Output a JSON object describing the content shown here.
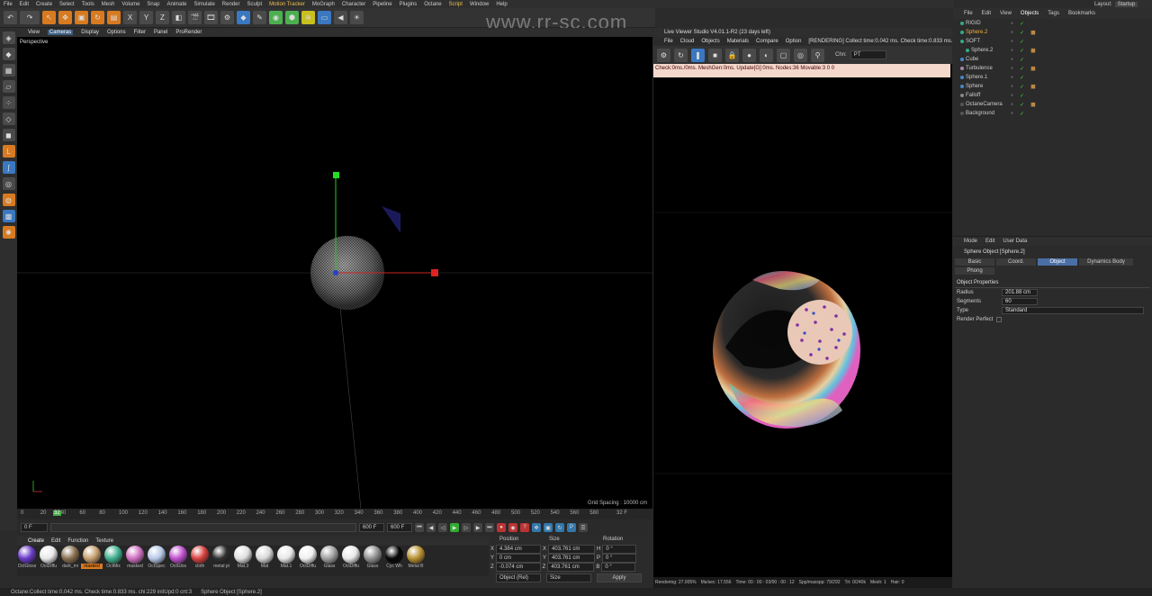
{
  "menu": [
    "File",
    "Edit",
    "Create",
    "Select",
    "Tools",
    "Mesh",
    "Volume",
    "Snap",
    "Animate",
    "Simulate",
    "Render",
    "Sculpt",
    "Motion Tracker",
    "MoGraph",
    "Character",
    "Pipeline",
    "Plugins",
    "Octane",
    "Script",
    "Window",
    "Help"
  ],
  "watermark": "www.rr-sc.com",
  "viewport": {
    "menu": [
      "View",
      "Cameras",
      "Display",
      "Options",
      "Filter",
      "Panel",
      "ProRender"
    ],
    "label": "Perspective",
    "grid_info": "Grid Spacing : 10000 cm"
  },
  "timeline": {
    "ticks": [
      "0",
      "20",
      "40",
      "60",
      "80",
      "100",
      "120",
      "140",
      "160",
      "180",
      "200",
      "220",
      "240",
      "260",
      "280",
      "300",
      "320",
      "340",
      "360",
      "380",
      "400",
      "420",
      "440",
      "460",
      "480",
      "500",
      "520",
      "540",
      "560",
      "580"
    ],
    "current": "32",
    "current_field": "32 F",
    "start_field": "0 F",
    "end_field": "600 F",
    "end_field2": "600 F"
  },
  "materials": {
    "tabs": [
      "Create",
      "Edit",
      "Function",
      "Texture"
    ],
    "items": [
      {
        "name": "OctGloss",
        "color": "#6a3cc8"
      },
      {
        "name": "OctDiffu",
        "color": "#e8e8e8"
      },
      {
        "name": "dark_mi",
        "color": "#8a7050"
      },
      {
        "name": "masked",
        "color": "#c8a070"
      },
      {
        "name": "OctMix",
        "color": "#40b090"
      },
      {
        "name": "masked",
        "color": "#d070c0"
      },
      {
        "name": "OctSpec",
        "color": "#b8c8e8"
      },
      {
        "name": "OctGlos",
        "color": "#c050d0"
      },
      {
        "name": "cloth",
        "color": "#d84040"
      },
      {
        "name": "metal pi",
        "color": "#303030"
      },
      {
        "name": "Mat.3",
        "color": "#e0e0e0"
      },
      {
        "name": "Mat",
        "color": "#d8d8d8"
      },
      {
        "name": "Mat.1",
        "color": "#e8e8e8"
      },
      {
        "name": "OctDiffu",
        "color": "#f0f0f0"
      },
      {
        "name": "Glass",
        "color": "#a0a0a0"
      },
      {
        "name": "OctDiffu",
        "color": "#e8e8e8"
      },
      {
        "name": "Glass",
        "color": "#909090"
      },
      {
        "name": "Cyc Wh",
        "color": "#050505"
      },
      {
        "name": "Metal B",
        "color": "#b89030"
      }
    ]
  },
  "coords": {
    "headers": [
      "Position",
      "Size",
      "Rotation"
    ],
    "rows": [
      {
        "axis": "X",
        "pos": "4.384 cm",
        "size": "403.761 cm",
        "rot_axis": "H",
        "rot": "0 °"
      },
      {
        "axis": "Y",
        "pos": "0 cm",
        "size": "403.761 cm",
        "rot_axis": "P",
        "rot": "0 °"
      },
      {
        "axis": "Z",
        "pos": "-0.074 cm",
        "size": "403.761 cm",
        "rot_axis": "B",
        "rot": "0 °"
      }
    ],
    "mode": "Object (Rel)",
    "size_mode": "Size",
    "apply": "Apply"
  },
  "status": {
    "left": "Octane:Collect time:0.042 ms.  Check time:0.833 ms.  chi:229  initUpd:0  cnt:3",
    "right": "Sphere Object [Sphere.2]"
  },
  "live_viewer": {
    "title": "Live Viewer Studio V4.01.1-R2 (23 days left)",
    "menu": [
      "File",
      "Cloud",
      "Objects",
      "Materials",
      "Compare",
      "Option",
      "[RENDERING] Collect time:0.042 ms.  Check time:0.833 ms."
    ],
    "chn_label": "Chn:",
    "chn_value": "PT",
    "info": "Check:0ms./0ms. MeshGen:0ms. Update[G]:0ms. Nodes:36 Movable:3  0 0",
    "status": [
      "Rendering: 27.005%",
      "Ms/sec: 17.556",
      "Time: 00 : 00 : 03/00 : 00 : 12",
      "Spp/maxspp: 79/292",
      "Tri: 0/240k",
      "Mesh: 1",
      "Hair: 0"
    ]
  },
  "object_manager": {
    "layout_label": "Layout:",
    "layout_value": "Startup",
    "tabs": [
      "File",
      "Edit",
      "View",
      "Objects",
      "Tags",
      "Bookmarks"
    ],
    "objects": [
      {
        "name": "RIGID",
        "indent": 0,
        "selected": false
      },
      {
        "name": "Sphere.2",
        "indent": 0,
        "selected": true
      },
      {
        "name": "SOFT",
        "indent": 0,
        "selected": false
      },
      {
        "name": "Sphere.2",
        "indent": 1,
        "selected": false
      },
      {
        "name": "Cube",
        "indent": 0,
        "selected": false
      },
      {
        "name": "Turbulence",
        "indent": 0,
        "selected": false
      },
      {
        "name": "Sphere.1",
        "indent": 0,
        "selected": false
      },
      {
        "name": "Sphere",
        "indent": 0,
        "selected": false
      },
      {
        "name": "Falloff",
        "indent": 0,
        "selected": false
      },
      {
        "name": "OctaneCamera",
        "indent": 0,
        "selected": false
      },
      {
        "name": "Background",
        "indent": 0,
        "selected": false
      }
    ]
  },
  "attributes": {
    "tabs": [
      "Mode",
      "Edit",
      "User Data"
    ],
    "title": "Sphere Object [Sphere.2]",
    "buttons": [
      "Basic",
      "Coord.",
      "Object",
      "Dynamics Body",
      "Phong"
    ],
    "selected_button": "Object",
    "section": "Object Properties",
    "props": [
      {
        "label": "Radius",
        "value": "201.88 cm"
      },
      {
        "label": "Segments",
        "value": "60"
      },
      {
        "label": "Type",
        "value": "Standard"
      },
      {
        "label": "Render Perfect",
        "value": ""
      }
    ]
  }
}
